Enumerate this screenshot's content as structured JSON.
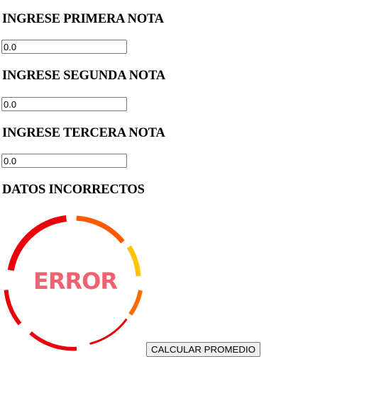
{
  "form": {
    "nota1": {
      "label": "INGRESE PRIMERA NOTA",
      "value": "0.0"
    },
    "nota2": {
      "label": "INGRESE SEGUNDA NOTA",
      "value": "0.0"
    },
    "nota3": {
      "label": "INGRESE TERCERA NOTA",
      "value": "0.0"
    },
    "status_message": "DATOS INCORRECTOS",
    "error_image": {
      "icon": "error-ring-icon",
      "text": "ERROR",
      "text_color": "#f06272",
      "ring_colors": [
        "#e8000b",
        "#ff7a00",
        "#ffd400"
      ]
    },
    "calculate_button": "CALCULAR PROMEDIO"
  }
}
